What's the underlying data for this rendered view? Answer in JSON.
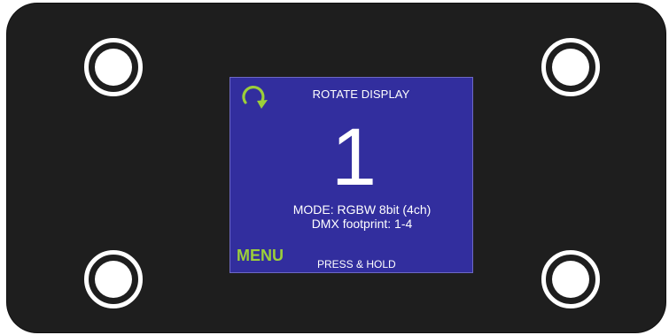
{
  "device": {
    "colors": {
      "panel": "#1e1e1e",
      "screen": "#322e9e",
      "accent": "#9ccf3a",
      "text": "#ffffff"
    }
  },
  "buttons": [
    {
      "name": "top-left-button"
    },
    {
      "name": "top-right-button"
    },
    {
      "name": "bottom-left-button"
    },
    {
      "name": "bottom-right-button"
    }
  ],
  "screen": {
    "rotate_icon": "rotate-clockwise-icon",
    "rotate_label": "ROTATE DISPLAY",
    "address": "1",
    "mode": "MODE: RGBW 8bit (4ch)",
    "footprint": "DMX footprint: 1-4",
    "menu_label": "MENU",
    "hold_label": "PRESS & HOLD"
  }
}
